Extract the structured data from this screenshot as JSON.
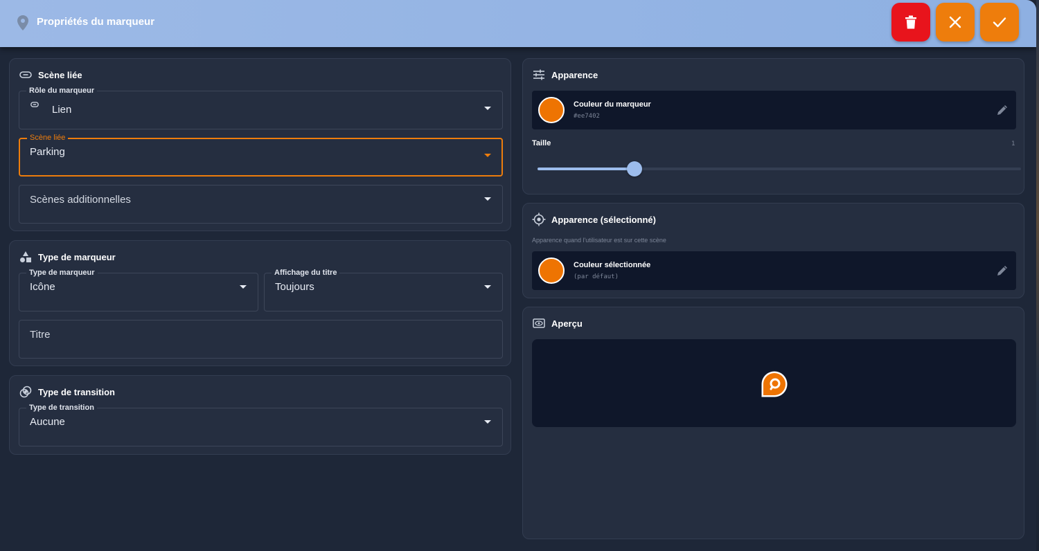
{
  "header": {
    "title": "Propriétés du marqueur",
    "delete_icon": "trash-icon",
    "cancel_icon": "close-icon",
    "confirm_icon": "check-icon"
  },
  "linked_scene": {
    "title": "Scène liée",
    "role_label": "Rôle du marqueur",
    "role_value": "Lien",
    "scene_label": "Scène liée",
    "scene_value": "Parking",
    "additional_placeholder": "Scènes additionnelles"
  },
  "marker_type": {
    "title": "Type de marqueur",
    "type_label": "Type de marqueur",
    "type_value": "Icône",
    "title_display_label": "Affichage du titre",
    "title_display_value": "Toujours",
    "title_placeholder": "Titre"
  },
  "transition": {
    "title": "Type de transition",
    "type_label": "Type de transition",
    "type_value": "Aucune"
  },
  "appearance": {
    "title": "Apparence",
    "color_name": "Couleur du marqueur",
    "color_hex": "#ee7402",
    "size_label": "Taille",
    "size_value": "1",
    "size_fraction": 0.2
  },
  "appearance_selected": {
    "title": "Apparence (sélectionné)",
    "description": "Apparence quand l'utilisateur est sur cette scène",
    "color_name": "Couleur sélectionnée",
    "color_value": "(par défaut)"
  },
  "preview": {
    "title": "Aperçu"
  },
  "colors": {
    "accent": "#ee7d0c",
    "marker": "#ee7402",
    "danger": "#e8141c",
    "header": "#9cb9e6"
  }
}
